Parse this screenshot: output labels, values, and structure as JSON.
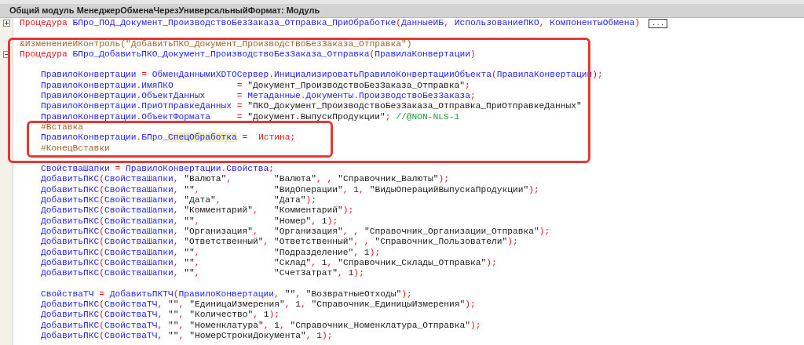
{
  "window": {
    "title": "Общий модуль МенеджерОбменаЧерезУниверсальныйФормат: Модуль"
  },
  "lines": [
    {
      "kind": "code",
      "expanded": false,
      "folded_label": "...",
      "columns": [
        [
          {
            "kind": "kw",
            "text": "Процедура"
          },
          {
            "kind": "code",
            "text": " БПро_ПОД_Документ_ПроизводствоБезЗаказа_Отправка_ПриОбработке(ДанныеИБ, ИспользованиеПКО, КомпонентыОбмена)"
          }
        ]
      ]
    },
    {
      "kind": "blank"
    },
    {
      "kind": "code",
      "columns": [
        [
          {
            "kind": "dir",
            "text": "&ИзменениеИКонтроль(\"ДобавитьПКО_Документ_ПроизводствоБезЗаказа_Отправка\")"
          }
        ]
      ]
    },
    {
      "kind": "code",
      "expanded": true,
      "columns": [
        [
          {
            "kind": "kw",
            "text": "Процедура"
          },
          {
            "kind": "code",
            "text": " БПро_ДобавитьПКО_Документ_ПроизводствоБезЗаказа_Отправка(ПравилаКонвертации)"
          }
        ]
      ],
      "children": [
        {
          "kind": "blank"
        },
        {
          "kind": "code",
          "columns": [
            [
              {
                "kind": "code",
                "text": "ПравилоКонвертации = ОбменДаннымиXDTOСервер.ИнициализироватьПравилоКонвертацииОбъекта(ПравилаКонвертации);"
              }
            ]
          ]
        },
        {
          "kind": "code",
          "columns": [
            [
              {
                "kind": "code",
                "text": "ПравилоКонвертации.ИмяПКО"
              }
            ],
            [
              {
                "kind": "code",
                "text": "= \"Документ_ПроизводствоБезЗаказа_Отправка\";"
              }
            ]
          ]
        },
        {
          "kind": "code",
          "columns": [
            [
              {
                "kind": "code",
                "text": "ПравилоКонвертации.ОбъектДанных"
              }
            ],
            [
              {
                "kind": "code",
                "text": "= Метаданные.Документы.ПроизводствоБезЗаказа;"
              }
            ]
          ]
        },
        {
          "kind": "code",
          "columns": [
            [
              {
                "kind": "code",
                "text": "ПравилоКонвертации.ПриОтправкеДанных"
              }
            ],
            [
              {
                "kind": "code",
                "text": "= \"ПКО_Документ_ПроизводствоБезЗаказа_Отправка_ПриОтправкеДанных\""
              }
            ]
          ]
        },
        {
          "kind": "code",
          "columns": [
            [
              {
                "kind": "code",
                "text": "ПравилоКонвертации.ОбъектФормата"
              }
            ],
            [
              {
                "kind": "code",
                "text": "= \"Документ.ВыпускПродукции\";"
              },
              {
                "kind": "cm",
                "text": " //@NON-NLS-1"
              }
            ]
          ]
        },
        {
          "kind": "code",
          "columns": [
            [
              {
                "kind": "dir",
                "text": "#Вставка"
              }
            ]
          ]
        },
        {
          "kind": "code",
          "columns": [
            [
              {
                "kind": "code",
                "text": "ПравилоКонвертации.БПро_"
              },
              {
                "kind": "hl",
                "text": "СпецОбработка"
              },
              {
                "kind": "code",
                "text": " =  "
              },
              {
                "kind": "kw",
                "text": "Истина"
              },
              {
                "kind": "code",
                "text": ";"
              }
            ]
          ]
        },
        {
          "kind": "code",
          "columns": [
            [
              {
                "kind": "dir",
                "text": "#КонецВставки"
              }
            ]
          ]
        },
        {
          "kind": "blank"
        },
        {
          "kind": "code",
          "columns": [
            [
              {
                "kind": "code",
                "text": "СвойстваШапки = ПравилоКонвертации.Свойства;"
              }
            ]
          ]
        },
        {
          "kind": "code",
          "columns": [
            [
              {
                "kind": "code",
                "text": "ДобавитьПКС(СвойстваШапки, \"Валюта\","
              }
            ],
            [
              {
                "kind": "code",
                "text": "\"Валюта\", , \"Справочник_Валюты\");"
              }
            ]
          ]
        },
        {
          "kind": "code",
          "columns": [
            [
              {
                "kind": "code",
                "text": "ДобавитьПКС(СвойстваШапки, \"\","
              }
            ],
            [
              {
                "kind": "code",
                "text": "\"ВидОперации\", 1, \"ВидыОперацийВыпускаПродукции\");"
              }
            ]
          ]
        },
        {
          "kind": "code",
          "columns": [
            [
              {
                "kind": "code",
                "text": "ДобавитьПКС(СвойстваШапки, \"Дата\","
              }
            ],
            [
              {
                "kind": "code",
                "text": "\"Дата\");"
              }
            ]
          ]
        },
        {
          "kind": "code",
          "columns": [
            [
              {
                "kind": "code",
                "text": "ДобавитьПКС(СвойстваШапки, \"Комментарий\","
              }
            ],
            [
              {
                "kind": "code",
                "text": "\"Комментарий\");"
              }
            ]
          ]
        },
        {
          "kind": "code",
          "columns": [
            [
              {
                "kind": "code",
                "text": "ДобавитьПКС(СвойстваШапки, \"\","
              }
            ],
            [
              {
                "kind": "code",
                "text": "\"Номер\", 1);"
              }
            ]
          ]
        },
        {
          "kind": "code",
          "columns": [
            [
              {
                "kind": "code",
                "text": "ДобавитьПКС(СвойстваШапки, \"Организация\","
              }
            ],
            [
              {
                "kind": "code",
                "text": "\"Организация\", , \"Справочник_Организации_Отправка\");"
              }
            ]
          ]
        },
        {
          "kind": "code",
          "columns": [
            [
              {
                "kind": "code",
                "text": "ДобавитьПКС(СвойстваШапки, \"Ответственный\","
              }
            ],
            [
              {
                "kind": "code",
                "text": "\"Ответственный\", , \"Справочник_Пользователи\");"
              }
            ]
          ]
        },
        {
          "kind": "code",
          "columns": [
            [
              {
                "kind": "code",
                "text": "ДобавитьПКС(СвойстваШапки, \"\","
              }
            ],
            [
              {
                "kind": "code",
                "text": "\"Подразделение\", 1);"
              }
            ]
          ]
        },
        {
          "kind": "code",
          "columns": [
            [
              {
                "kind": "code",
                "text": "ДобавитьПКС(СвойстваШапки, \"\","
              }
            ],
            [
              {
                "kind": "code",
                "text": "\"Склад\", 1, \"Справочник_Склады_Отправка\");"
              }
            ]
          ]
        },
        {
          "kind": "code",
          "columns": [
            [
              {
                "kind": "code",
                "text": "ДобавитьПКС(СвойстваШапки, \"\","
              }
            ],
            [
              {
                "kind": "code",
                "text": "\"СчетЗатрат\", 1);"
              }
            ]
          ]
        },
        {
          "kind": "blank"
        },
        {
          "kind": "code",
          "columns": [
            [
              {
                "kind": "code",
                "text": "СвойстваТЧ = ДобавитьПКТЧ(ПравилоКонвертации, \"\", \"ВозвратныеОтходы\");"
              }
            ]
          ]
        },
        {
          "kind": "code",
          "columns": [
            [
              {
                "kind": "code",
                "text": "ДобавитьПКС(СвойстваТЧ, \"\", \"ЕдиницаИзмерения\", 1, \"Справочник_ЕдиницыИзмерения\");"
              }
            ]
          ]
        },
        {
          "kind": "code",
          "columns": [
            [
              {
                "kind": "code",
                "text": "ДобавитьПКС(СвойстваТЧ, \"\", \"Количество\", 1);"
              }
            ]
          ]
        },
        {
          "kind": "code",
          "columns": [
            [
              {
                "kind": "code",
                "text": "ДобавитьПКС(СвойстваТЧ, \"\", \"Номенклатура\", 1, \"Справочник_Номенклатура_Отправка\");"
              }
            ]
          ]
        },
        {
          "kind": "code",
          "columns": [
            [
              {
                "kind": "code",
                "text": "ДобавитьПКС(СвойстваТЧ, \"\", \"НомерСтрокиДокумента\", 1);"
              }
            ]
          ]
        }
      ]
    }
  ]
}
